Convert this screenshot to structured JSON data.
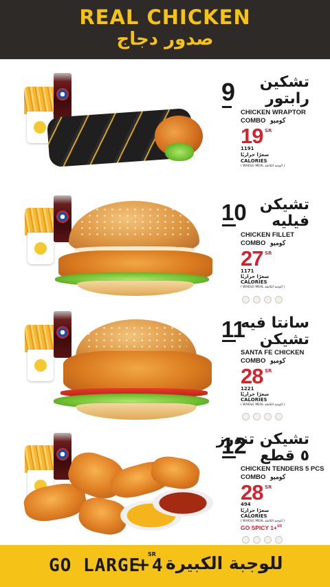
{
  "header": {
    "title_en": "REAL CHICKEN",
    "title_ar": "صدور دجاج"
  },
  "items": [
    {
      "number": "9",
      "name_ar_1": "تشكين",
      "name_ar_2": "رابتور",
      "name_en": "CHICKEN WRAPTOR",
      "combo_en": "COMBO",
      "combo_ar": "كومبو",
      "price": "19",
      "currency": "SR",
      "calories": "1191",
      "calories_ar": "سعرًا حراريًا",
      "calories_en": "CALORIES",
      "whole_meal": "( WHOLE MEAL الوجبة الكاملة )"
    },
    {
      "number": "10",
      "name_ar_1": "تشيكن",
      "name_ar_2": "فيليه",
      "name_en": "CHICKEN FILLET",
      "combo_en": "COMBO",
      "combo_ar": "كومبو",
      "price": "27",
      "currency": "SR",
      "calories": "1171",
      "calories_ar": "سعرًا حراريًا",
      "calories_en": "CALORIES",
      "whole_meal": "( WHOLE MEAL الوجبة الكاملة )"
    },
    {
      "number": "11",
      "name_ar_1": "سانتا فيه",
      "name_ar_2": "تشيكن",
      "name_en": "SANTA FE CHICKEN",
      "combo_en": "COMBO",
      "combo_ar": "كومبو",
      "price": "28",
      "currency": "SR",
      "calories": "1221",
      "calories_ar": "سعرًا حراريًا",
      "calories_en": "CALORIES",
      "whole_meal": "( WHOLE MEAL الوجبة الكاملة )"
    },
    {
      "number": "12",
      "name_ar_1": "تشيكن تندرز",
      "name_ar_2": "٥ قطع",
      "name_en": "CHICKEN TENDERS 5 PCS",
      "combo_en": "COMBO",
      "combo_ar": "كومبو",
      "price": "28",
      "currency": "SR",
      "calories": "494",
      "calories_ar": "سعرًا حراريًا",
      "calories_en": "CALORIES",
      "whole_meal": "( WHOLE MEAL الوجبة الكاملة )",
      "spicy": "GO SPICY 1+",
      "spicy_sr": "SR"
    }
  ],
  "footer": {
    "go_large": "GO LARGE 4",
    "plus": "+",
    "currency": "SR",
    "text_ar": "للوجبة الكبيرة"
  },
  "colors": {
    "header_bg": "#2d2a27",
    "accent_yellow": "#f5c218",
    "price_red": "#d3232f"
  }
}
